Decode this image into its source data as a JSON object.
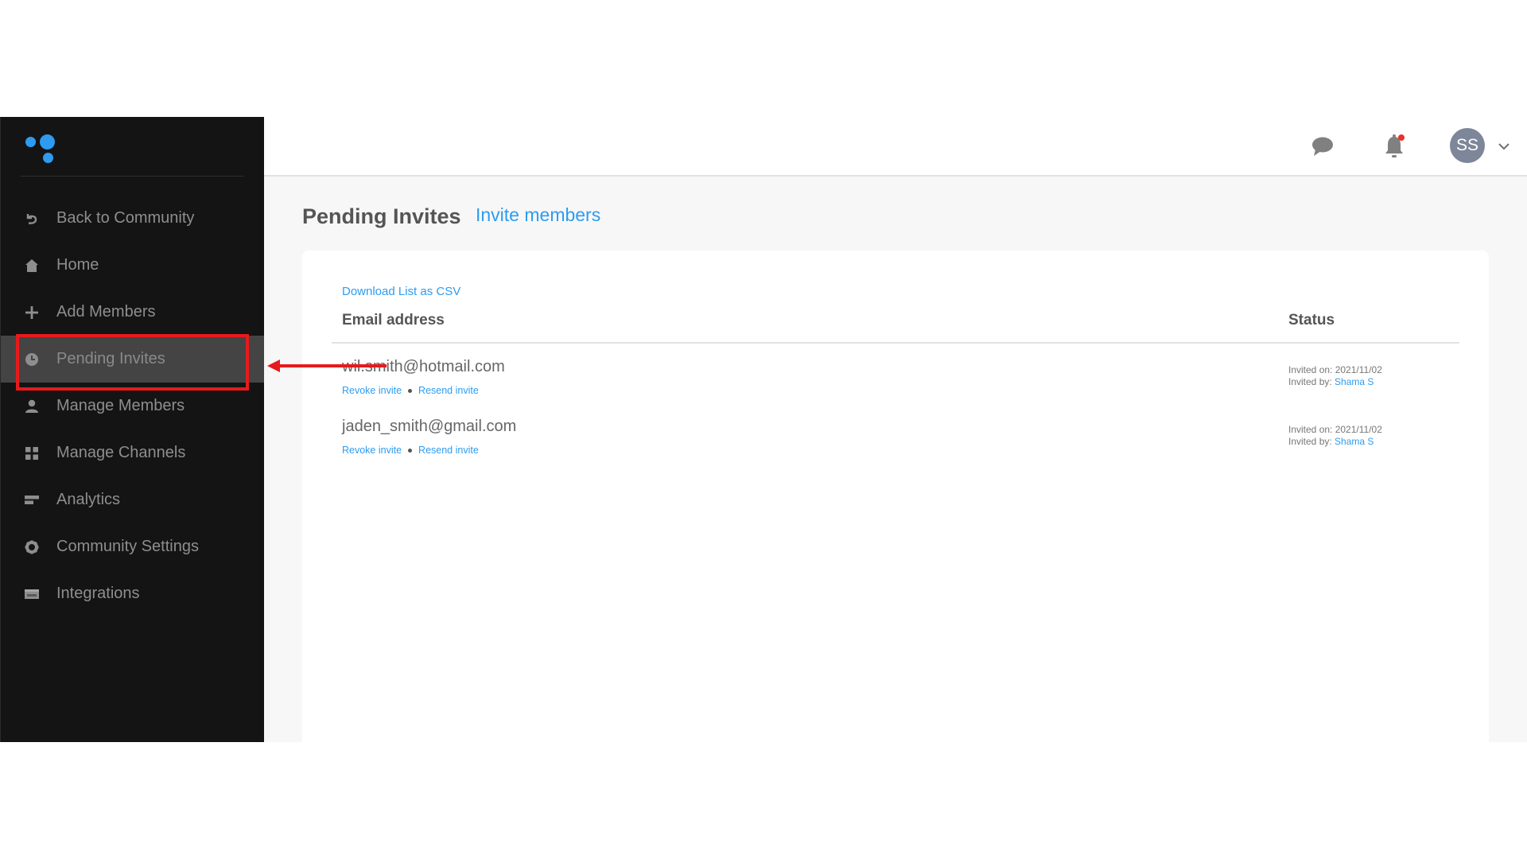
{
  "app": {
    "logo": "three-dots-logo",
    "colors": {
      "accent": "#2d9cf0",
      "sidebar_bg": "#141414",
      "active_bg": "#444444",
      "notification": "#e8322e",
      "annotation": "#e8191c"
    }
  },
  "sidebar": {
    "items": [
      {
        "label": "Back to Community",
        "icon": "back-arrow-icon",
        "active": false
      },
      {
        "label": "Home",
        "icon": "home-icon",
        "active": false
      },
      {
        "label": "Add Members",
        "icon": "plus-icon",
        "active": false
      },
      {
        "label": "Pending Invites",
        "icon": "clock-icon",
        "active": true
      },
      {
        "label": "Manage Members",
        "icon": "user-icon",
        "active": false
      },
      {
        "label": "Manage Channels",
        "icon": "grid-icon",
        "active": false
      },
      {
        "label": "Analytics",
        "icon": "bars-icon",
        "active": false
      },
      {
        "label": "Community Settings",
        "icon": "gear-icon",
        "active": false
      },
      {
        "label": "Integrations",
        "icon": "integrations-icon",
        "active": false
      }
    ]
  },
  "header": {
    "chat_icon": "chat-bubble-icon",
    "bell_icon": "bell-icon",
    "has_notification": true,
    "avatar_initials": "SS",
    "menu_icon": "chevron-down-icon"
  },
  "main": {
    "title": "Pending Invites",
    "invite_link": "Invite members",
    "download_link": "Download List as CSV",
    "columns": {
      "email": "Email address",
      "status": "Status"
    },
    "invites": [
      {
        "email": "wil.smith@hotmail.com",
        "revoke": "Revoke invite",
        "resend": "Resend invite",
        "invited_on_label": "Invited on: 2021/11/02",
        "invited_by_label": "Invited by: ",
        "invited_by": "Shama S"
      },
      {
        "email": "jaden_smith@gmail.com",
        "revoke": "Revoke invite",
        "resend": "Resend invite",
        "invited_on_label": "Invited on: 2021/11/02",
        "invited_by_label": "Invited by: ",
        "invited_by": "Shama S"
      }
    ]
  },
  "annotation": {
    "highlight_target": "Pending Invites",
    "type": "red-box-with-arrow"
  }
}
